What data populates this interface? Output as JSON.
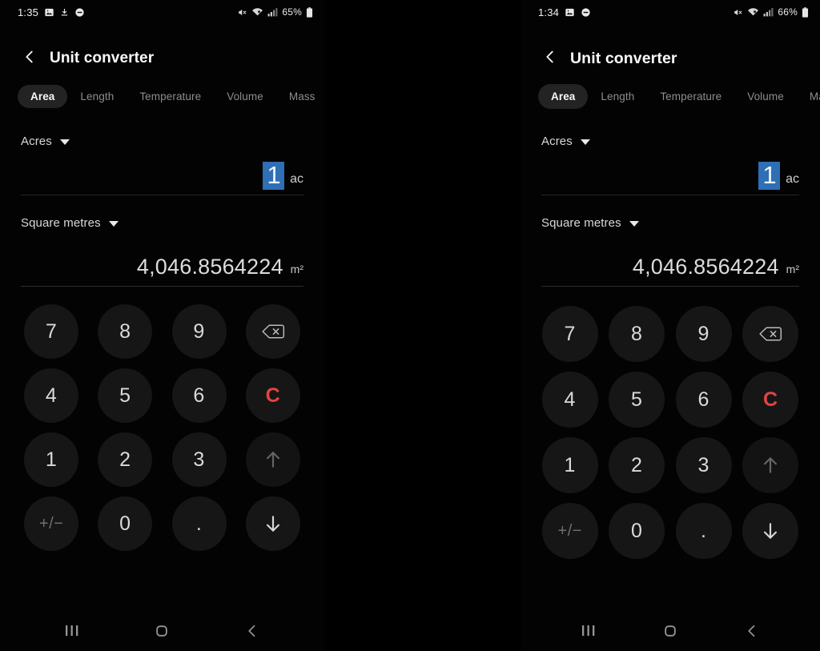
{
  "panels": [
    {
      "id": "left-phone",
      "status": {
        "clock": "1:35",
        "icons": [
          "photo-icon",
          "download-icon",
          "do-not-disturb-icon"
        ],
        "right_icons": [
          "mute-icon",
          "wifi-icon",
          "cellular-signal-icon"
        ],
        "battery_text": "65%",
        "battery_icon": "battery-icon"
      },
      "appbar": {
        "back_icon": "chevron-left-icon",
        "title": "Unit converter"
      },
      "tabs": [
        {
          "label": "Area",
          "active": true
        },
        {
          "label": "Length",
          "active": false
        },
        {
          "label": "Temperature",
          "active": false
        },
        {
          "label": "Volume",
          "active": false
        },
        {
          "label": "Mass",
          "active": false
        }
      ],
      "input": {
        "unit_label": "Acres",
        "caret_icon": "chevron-down-icon",
        "value": "1",
        "value_selected": true,
        "unit_abbrev": "ac"
      },
      "output": {
        "unit_label": "Square metres",
        "caret_icon": "chevron-down-icon",
        "value": "4,046.8564224",
        "unit_abbrev": "m²"
      },
      "keypad": [
        {
          "label": "7",
          "name": "key-7",
          "kind": "digit"
        },
        {
          "label": "8",
          "name": "key-8",
          "kind": "digit"
        },
        {
          "label": "9",
          "name": "key-9",
          "kind": "digit"
        },
        {
          "label": "",
          "name": "backspace-key",
          "kind": "backspace",
          "icon": "backspace-icon"
        },
        {
          "label": "4",
          "name": "key-4",
          "kind": "digit"
        },
        {
          "label": "5",
          "name": "key-5",
          "kind": "digit"
        },
        {
          "label": "6",
          "name": "key-6",
          "kind": "digit"
        },
        {
          "label": "C",
          "name": "clear-key",
          "kind": "clear"
        },
        {
          "label": "1",
          "name": "key-1",
          "kind": "digit"
        },
        {
          "label": "2",
          "name": "key-2",
          "kind": "digit"
        },
        {
          "label": "3",
          "name": "key-3",
          "kind": "digit"
        },
        {
          "label": "",
          "name": "move-up-key",
          "kind": "up",
          "icon": "arrow-up-icon"
        },
        {
          "label": "+/−",
          "name": "sign-toggle-key",
          "kind": "sign"
        },
        {
          "label": "0",
          "name": "key-0",
          "kind": "digit"
        },
        {
          "label": ".",
          "name": "decimal-point-key",
          "kind": "dot"
        },
        {
          "label": "",
          "name": "move-down-key",
          "kind": "down",
          "icon": "arrow-down-icon"
        }
      ],
      "navbar": [
        "recents-icon",
        "home-icon",
        "back-icon"
      ]
    },
    {
      "id": "right-phone",
      "status": {
        "clock": "1:34",
        "icons": [
          "photo-icon",
          "do-not-disturb-icon"
        ],
        "right_icons": [
          "mute-icon",
          "wifi-icon",
          "cellular-signal-icon"
        ],
        "battery_text": "66%",
        "battery_icon": "battery-icon"
      },
      "appbar": {
        "back_icon": "chevron-left-icon",
        "title": "Unit converter"
      },
      "tabs": [
        {
          "label": "Area",
          "active": true
        },
        {
          "label": "Length",
          "active": false
        },
        {
          "label": "Temperature",
          "active": false
        },
        {
          "label": "Volume",
          "active": false
        },
        {
          "label": "Mas",
          "active": false
        }
      ],
      "input": {
        "unit_label": "Acres",
        "caret_icon": "chevron-down-icon",
        "value": "1",
        "value_selected": true,
        "unit_abbrev": "ac"
      },
      "output": {
        "unit_label": "Square metres",
        "caret_icon": "chevron-down-icon",
        "value": "4,046.8564224",
        "unit_abbrev": "m²"
      },
      "keypad": [
        {
          "label": "7",
          "name": "key-7",
          "kind": "digit"
        },
        {
          "label": "8",
          "name": "key-8",
          "kind": "digit"
        },
        {
          "label": "9",
          "name": "key-9",
          "kind": "digit"
        },
        {
          "label": "",
          "name": "backspace-key",
          "kind": "backspace",
          "icon": "backspace-icon"
        },
        {
          "label": "4",
          "name": "key-4",
          "kind": "digit"
        },
        {
          "label": "5",
          "name": "key-5",
          "kind": "digit"
        },
        {
          "label": "6",
          "name": "key-6",
          "kind": "digit"
        },
        {
          "label": "C",
          "name": "clear-key",
          "kind": "clear"
        },
        {
          "label": "1",
          "name": "key-1",
          "kind": "digit"
        },
        {
          "label": "2",
          "name": "key-2",
          "kind": "digit"
        },
        {
          "label": "3",
          "name": "key-3",
          "kind": "digit"
        },
        {
          "label": "",
          "name": "move-up-key",
          "kind": "up",
          "icon": "arrow-up-icon"
        },
        {
          "label": "+/−",
          "name": "sign-toggle-key",
          "kind": "sign"
        },
        {
          "label": "0",
          "name": "key-0",
          "kind": "digit"
        },
        {
          "label": ".",
          "name": "decimal-point-key",
          "kind": "dot"
        },
        {
          "label": "",
          "name": "move-down-key",
          "kind": "down",
          "icon": "arrow-down-icon"
        }
      ],
      "navbar": [
        "recents-icon",
        "home-icon",
        "back-icon"
      ]
    }
  ],
  "colors": {
    "background": "#000000",
    "surface": "#161616",
    "selection_blue": "#2e6fb5",
    "clear_red": "#e04444",
    "text_primary": "#f7f7f7",
    "text_secondary": "#8d8d8d",
    "tab_pill": "#232323"
  }
}
